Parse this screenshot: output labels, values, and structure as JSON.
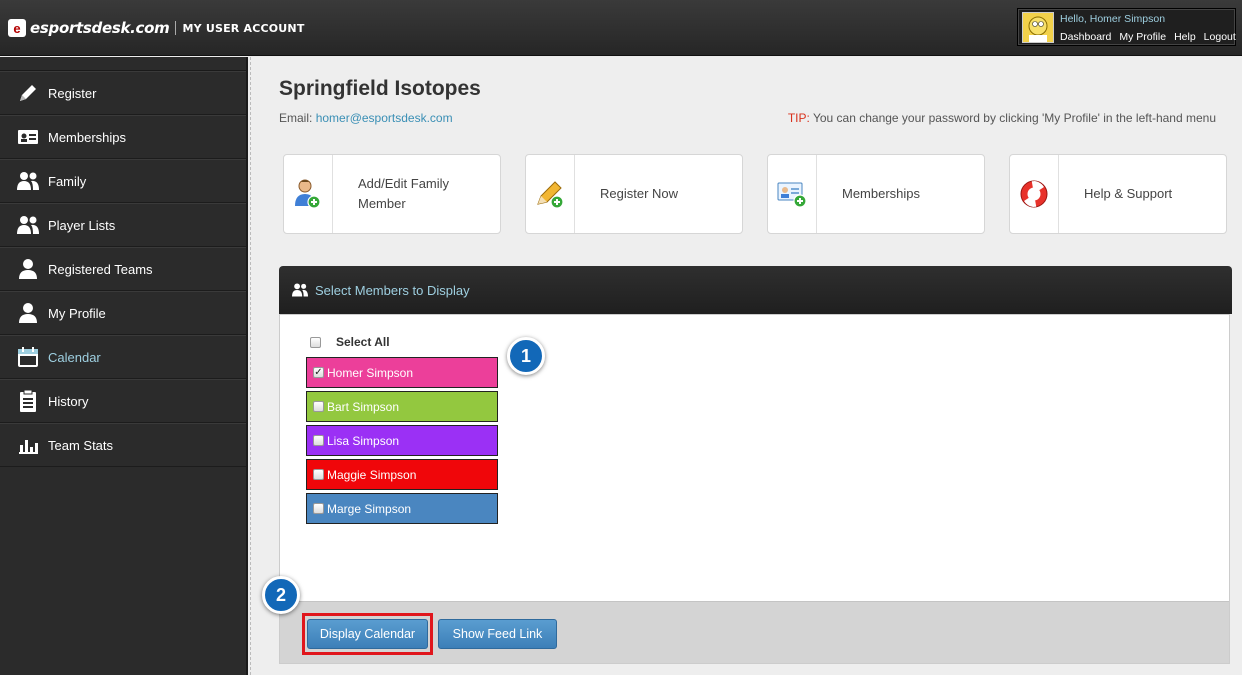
{
  "header": {
    "logo_mark": "e",
    "logo_text": "esportsdesk.com",
    "section_title": "MY USER ACCOUNT",
    "greeting": "Hello, Homer Simpson",
    "links": [
      "Dashboard",
      "My Profile",
      "Help",
      "Logout"
    ]
  },
  "sidebar": {
    "items": [
      {
        "label": "Register",
        "icon": "pencil-icon"
      },
      {
        "label": "Memberships",
        "icon": "id-card-icon"
      },
      {
        "label": "Family",
        "icon": "users-icon"
      },
      {
        "label": "Player Lists",
        "icon": "users-icon"
      },
      {
        "label": "Registered Teams",
        "icon": "user-icon"
      },
      {
        "label": "My Profile",
        "icon": "user-icon"
      },
      {
        "label": "Calendar",
        "icon": "calendar-icon",
        "active": true
      },
      {
        "label": "History",
        "icon": "clipboard-icon"
      },
      {
        "label": "Team Stats",
        "icon": "bar-chart-icon"
      }
    ]
  },
  "main": {
    "title": "Springfield Isotopes",
    "email_label": "Email: ",
    "email": "homer@esportsdesk.com",
    "tip_label": "TIP:",
    "tip_text": " You can change your password by clicking 'My Profile' in the left-hand menu",
    "tiles": [
      {
        "label": "Add/Edit Family Member",
        "icon": "add-user-icon"
      },
      {
        "label": "Register Now",
        "icon": "pencil-add-icon"
      },
      {
        "label": "Memberships",
        "icon": "card-add-icon"
      },
      {
        "label": "Help & Support",
        "icon": "lifebuoy-icon"
      }
    ],
    "panel_title": "Select Members to Display",
    "select_all_label": "Select All",
    "members": [
      {
        "name": "Homer Simpson",
        "color": "#ec3f9a",
        "checked": true
      },
      {
        "name": "Bart Simpson",
        "color": "#93c83f",
        "checked": false
      },
      {
        "name": "Lisa Simpson",
        "color": "#9b30f5",
        "checked": false
      },
      {
        "name": "Maggie Simpson",
        "color": "#f0060a",
        "checked": false
      },
      {
        "name": "Marge Simpson",
        "color": "#4a86c0",
        "checked": false
      }
    ],
    "buttons": {
      "display_calendar": "Display Calendar",
      "show_feed_link": "Show Feed Link"
    },
    "callouts": [
      "1",
      "2"
    ]
  }
}
